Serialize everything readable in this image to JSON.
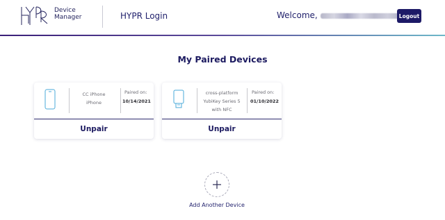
{
  "header": {
    "logo_text_line1": "Device",
    "logo_text_line2": "Manager",
    "app_title": "HYPR Login",
    "welcome_prefix": "Welcome,",
    "logout_label": "Logout"
  },
  "colors": {
    "brand_navy": "#1d1a67",
    "accent_teal": "#6db8c9",
    "device_icon": "#4aaad8"
  },
  "main": {
    "title": "My Paired Devices",
    "devices": [
      {
        "icon": "smartphone-icon",
        "name_lines": [
          "CC iPhone",
          "iPhone"
        ],
        "paired_label": "Paired on:",
        "paired_date": "10/14/2021",
        "action_label": "Unpair"
      },
      {
        "icon": "security-key-icon",
        "name_lines": [
          "cross-platform",
          "YubiKey Series 5",
          "with NFC"
        ],
        "paired_label": "Paired on:",
        "paired_date": "01/10/2022",
        "action_label": "Unpair"
      }
    ],
    "add_icon": "plus-icon",
    "add_label": "Add Another Device"
  }
}
